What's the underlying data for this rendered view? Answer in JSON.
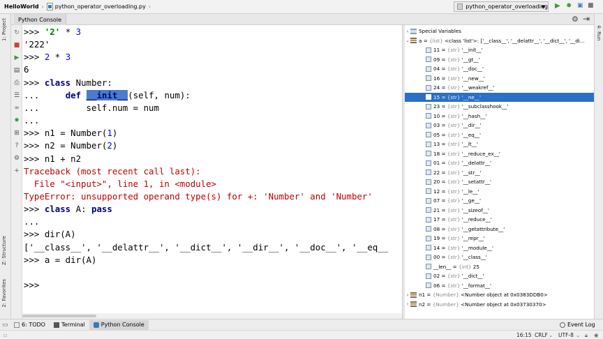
{
  "navbar": {
    "project": "HelloWorld",
    "file": "python_operator_overloading.py",
    "run_config": "python_operator_overloading"
  },
  "left_strip": {
    "project_label": "1: Project",
    "structure_label": "Z: Structure",
    "favorites_label": "2: Favorites"
  },
  "right_strip": {
    "label": "4: Run"
  },
  "console": {
    "tab_label": "Python Console",
    "lines": [
      [
        {
          "t": "prompt",
          "v": ">>> "
        },
        {
          "t": "str",
          "v": "'2'"
        },
        {
          "t": "plain",
          "v": " * "
        },
        {
          "t": "num",
          "v": "3"
        }
      ],
      [
        {
          "t": "plain",
          "v": "'222'"
        }
      ],
      [
        {
          "t": "prompt",
          "v": ">>> "
        },
        {
          "t": "num",
          "v": "2"
        },
        {
          "t": "plain",
          "v": " * "
        },
        {
          "t": "num",
          "v": "3"
        }
      ],
      [
        {
          "t": "plain",
          "v": "6"
        }
      ],
      [
        {
          "t": "prompt",
          "v": ">>> "
        },
        {
          "t": "kw",
          "v": "class"
        },
        {
          "t": "plain",
          "v": " Number:"
        }
      ],
      [
        {
          "t": "plain",
          "v": "...     "
        },
        {
          "t": "kw",
          "v": "def"
        },
        {
          "t": "plain",
          "v": " "
        },
        {
          "t": "sel",
          "v": "__init__"
        },
        {
          "t": "plain",
          "v": "(self, num):"
        }
      ],
      [
        {
          "t": "plain",
          "v": "...         self.num = num"
        }
      ],
      [
        {
          "t": "plain",
          "v": "..."
        }
      ],
      [
        {
          "t": "prompt",
          "v": ">>> "
        },
        {
          "t": "plain",
          "v": "n1 = Number("
        },
        {
          "t": "num",
          "v": "1"
        },
        {
          "t": "plain",
          "v": ")"
        }
      ],
      [
        {
          "t": "prompt",
          "v": ">>> "
        },
        {
          "t": "plain",
          "v": "n2 = Number("
        },
        {
          "t": "num",
          "v": "2"
        },
        {
          "t": "plain",
          "v": ")"
        }
      ],
      [
        {
          "t": "prompt",
          "v": ">>> "
        },
        {
          "t": "plain",
          "v": "n1 + n2"
        }
      ],
      [
        {
          "t": "err",
          "v": "Traceback (most recent call last):"
        }
      ],
      [
        {
          "t": "err",
          "v": "  File \"<input>\", line 1, in <module>"
        }
      ],
      [
        {
          "t": "err",
          "v": "TypeError: unsupported operand type(s) for +: 'Number' and 'Number'"
        }
      ],
      [
        {
          "t": "prompt",
          "v": ">>> "
        },
        {
          "t": "kw",
          "v": "class"
        },
        {
          "t": "plain",
          "v": " A: "
        },
        {
          "t": "kw",
          "v": "pass"
        }
      ],
      [
        {
          "t": "plain",
          "v": "..."
        }
      ],
      [
        {
          "t": "prompt",
          "v": ">>> "
        },
        {
          "t": "plain",
          "v": "dir(A)"
        }
      ],
      [
        {
          "t": "plain",
          "v": "['__class__', '__delattr__', '__dict__', '__dir__', '__doc__', '__eq__"
        }
      ],
      [
        {
          "t": "prompt",
          "v": ">>> "
        },
        {
          "t": "plain",
          "v": "a = dir(A)"
        }
      ],
      [
        {
          "t": "plain",
          "v": ""
        }
      ],
      [
        {
          "t": "prompt",
          "v": ">>>"
        }
      ]
    ]
  },
  "variables": {
    "special": "Special Variables",
    "root": {
      "name": "a",
      "type": "{list}",
      "value": "<class 'list'>: ['__class__', '__delattr__', '__dict__', '__di..."
    },
    "items": [
      {
        "idx": "11",
        "type": "{str}",
        "val": "'__init__'"
      },
      {
        "idx": "09",
        "type": "{str}",
        "val": "'__gt__'"
      },
      {
        "idx": "04",
        "type": "{str}",
        "val": "'__doc__'"
      },
      {
        "idx": "16",
        "type": "{str}",
        "val": "'__new__'"
      },
      {
        "idx": "24",
        "type": "{str}",
        "val": "'__weakref__'"
      },
      {
        "idx": "15",
        "type": "{str}",
        "val": "'__ne__'"
      },
      {
        "idx": "23",
        "type": "{str}",
        "val": "'__subclasshook__'"
      },
      {
        "idx": "10",
        "type": "{str}",
        "val": "'__hash__'"
      },
      {
        "idx": "03",
        "type": "{str}",
        "val": "'__dir__'"
      },
      {
        "idx": "05",
        "type": "{str}",
        "val": "'__eq__'"
      },
      {
        "idx": "13",
        "type": "{str}",
        "val": "'__lt__'"
      },
      {
        "idx": "18",
        "type": "{str}",
        "val": "'__reduce_ex__'"
      },
      {
        "idx": "01",
        "type": "{str}",
        "val": "'__delattr__'"
      },
      {
        "idx": "22",
        "type": "{str}",
        "val": "'__str__'"
      },
      {
        "idx": "20",
        "type": "{str}",
        "val": "'__setattr__'"
      },
      {
        "idx": "12",
        "type": "{str}",
        "val": "'__le__'"
      },
      {
        "idx": "07",
        "type": "{str}",
        "val": "'__ge__'"
      },
      {
        "idx": "21",
        "type": "{str}",
        "val": "'__sizeof__'"
      },
      {
        "idx": "17",
        "type": "{str}",
        "val": "'__reduce__'"
      },
      {
        "idx": "08",
        "type": "{str}",
        "val": "'__getattribute__'"
      },
      {
        "idx": "19",
        "type": "{str}",
        "val": "'__repr__'"
      },
      {
        "idx": "14",
        "type": "{str}",
        "val": "'__module__'"
      },
      {
        "idx": "00",
        "type": "{str}",
        "val": "'__class__'"
      },
      {
        "idx": "__len__",
        "type": "{int}",
        "val": "25"
      },
      {
        "idx": "02",
        "type": "{str}",
        "val": "'__dict__'"
      },
      {
        "idx": "06",
        "type": "{str}",
        "val": "'__format__'"
      }
    ],
    "selected_index": 5,
    "n1": {
      "name": "n1",
      "type": "{Number}",
      "value": "<Number object at 0x0383DDB0>"
    },
    "n2": {
      "name": "n2",
      "type": "{Number}",
      "value": "<Number object at 0x03730370>"
    }
  },
  "bottom_tabs": {
    "todo": "6: TODO",
    "terminal": "Terminal",
    "console": "Python Console",
    "event_log": "Event Log"
  },
  "status": {
    "position": "16:15",
    "line_sep": "CRLF",
    "encoding": "UTF-8"
  },
  "colors": {
    "selection": "#2b6fc7",
    "keyword": "#000080",
    "string": "#008000",
    "error": "#c00000"
  }
}
